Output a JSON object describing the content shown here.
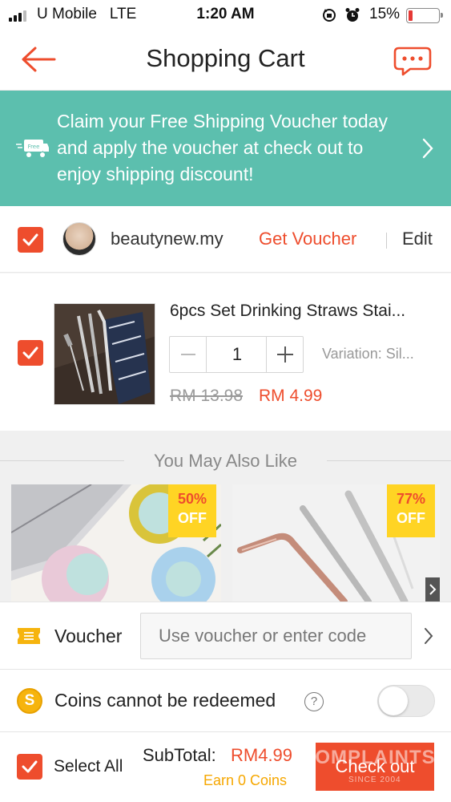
{
  "status_bar": {
    "carrier": "U Mobile",
    "network": "LTE",
    "time": "1:20 AM",
    "battery_percent": "15%",
    "battery_level": 0.15
  },
  "header": {
    "title": "Shopping Cart"
  },
  "banner": {
    "badge": "Free",
    "text": "Claim your Free Shipping Voucher today and apply the voucher at check out to enjoy shipping discount!"
  },
  "shop": {
    "name": "beautynew.my",
    "get_voucher": "Get Voucher",
    "edit": "Edit"
  },
  "product": {
    "name": "6pcs Set Drinking Straws Stai...",
    "quantity": "1",
    "variation": "Variation: Sil...",
    "price_original": "RM 13.98",
    "price_current": "RM 4.99"
  },
  "recommendations": {
    "title": "You May Also Like",
    "items": [
      {
        "discount": "50%",
        "off": "OFF"
      },
      {
        "discount": "77%",
        "off": "OFF"
      }
    ]
  },
  "voucher": {
    "label": "Voucher",
    "placeholder": "Use voucher or enter code"
  },
  "coins": {
    "label": "Coins cannot be redeemed",
    "help": "?",
    "coin_symbol": "S"
  },
  "bottom": {
    "select_all": "Select All",
    "subtotal_label": "SubTotal:",
    "subtotal_value": "RM4.99",
    "earn_coins": "Earn 0 Coins",
    "checkout": "Check out"
  },
  "watermark": {
    "line1": "COMPLAINTS",
    "line2": "SINCE 2004"
  },
  "colors": {
    "accent": "#ee4d2d",
    "banner": "#5cbfae",
    "coin": "#f6b40e",
    "discount_badge": "#ffd424"
  }
}
